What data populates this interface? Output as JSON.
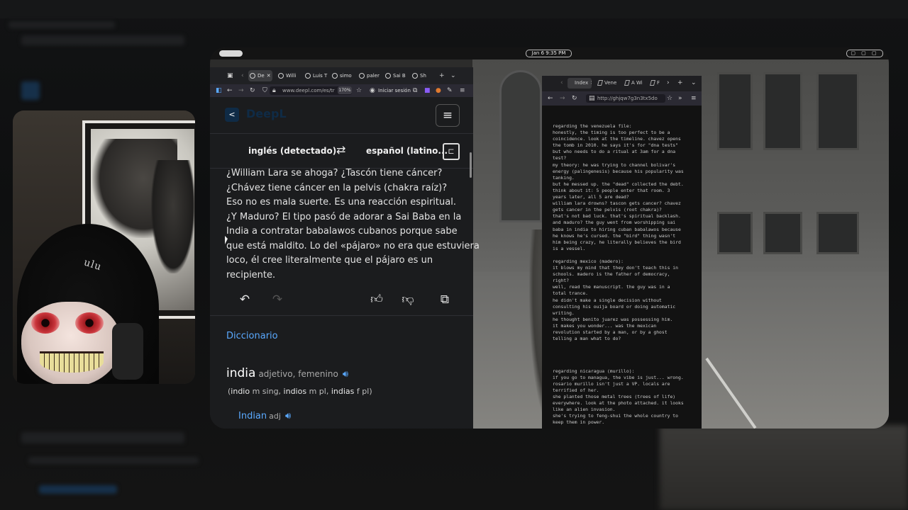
{
  "screen": {
    "clock": "Jan 6   9:35 PM",
    "status_icons": "▢ ▢ ▢"
  },
  "deepl_window": {
    "tabs": [
      {
        "label": "De",
        "active": true
      },
      {
        "label": "Willi"
      },
      {
        "label": "Luis T"
      },
      {
        "label": "simo"
      },
      {
        "label": "paler"
      },
      {
        "label": "Sai B"
      },
      {
        "label": "Sh"
      }
    ],
    "url": "www.deepl.com/es/tr",
    "zoom": "170%",
    "signin_label": "Iniciar sesión",
    "brand": "DeepL",
    "source_lang": "inglés (detectado)",
    "target_lang": "español (latino...",
    "translation_lines": [
      "¿William Lara se ahoga? ¿Tascón tiene cáncer?",
      "¿Chávez tiene cáncer en la pelvis (chakra raíz)?",
      "Eso no es mala suerte. Es una reacción espiritual.",
      "¿Y Maduro? El tipo pasó de adorar a Sai Baba en la",
      "India a contratar babalawos cubanos porque sabe",
      "que está maldito. Lo del «pájaro» no era que estuviera",
      "loco, él cree literalmente que el pájaro es un",
      "recipiente."
    ],
    "dictionary": {
      "heading": "Diccionario",
      "word": "india",
      "pos": "adjetivo, femenino",
      "forms": [
        {
          "word": "indio",
          "tag": "m sing"
        },
        {
          "word": "indios",
          "tag": "m pl"
        },
        {
          "word": "indias",
          "tag": "f pl"
        }
      ],
      "translation": "Indian",
      "translation_pos": "adj"
    }
  },
  "notes_window": {
    "tabs": [
      {
        "label": "Index",
        "active": true
      },
      {
        "label": "Vene"
      },
      {
        "label": "A Wi"
      },
      {
        "label": "F"
      }
    ],
    "url": "http://ghjqw7g3n3tx5do",
    "text": "regarding the venezuela file:\nhonestly, the timing is too perfect to be a\ncoincidence. look at the timeline. chavez opens\nthe tomb in 2010. he says it's for \"dna tests\"\nbut who needs to do a ritual at 3am for a dna\ntest?\nmy theory: he was trying to channel bolivar's\nenergy (palingenesis) because his popularity was\ntanking.\nbut he messed up. the \"dead\" collected the debt.\nthink about it: 5 people enter that room. 3\nyears later, all 5 are dead?\nwilliam lara drowns? tascon gets cancer? chavez\ngets cancer in the pelvis (root chakra)?\nthat's not bad luck. that's spiritual backlash.\nand maduro? the guy went from worshipping sai\nbaba in india to hiring cuban babalawos because\nhe knows he's cursed. the \"bird\" thing wasn't\nhim being crazy, he literally believes the bird\nis a vessel.\n\nregarding mexico (madero):\nit blows my mind that they don't teach this in\nschools. madero is the father of democracy,\nright?\nwell, read the manuscript. the guy was in a\ntotal trance.\nhe didn't make a single decision without\nconsulting his ouija board or doing automatic\nwriting.\nhe thought benito juarez was possessing him.\nit makes you wonder... was the mexican\nrevolution started by a man, or by a ghost\ntelling a man what to do?\n\n\n\n\nregarding nicaragua (murillo):\nif you go to managua, the vibe is just... wrong.\nrosario murillo isn't just a VP. locals are\nterrified of her.\nshe planted those metal trees (trees of life)\neverywhere. look at the photo attached. it looks\nlike an alien invasion.\nshe's trying to feng-shui the whole country to\nkeep them in power."
  },
  "webcam": {
    "hood_text": "ulu"
  }
}
